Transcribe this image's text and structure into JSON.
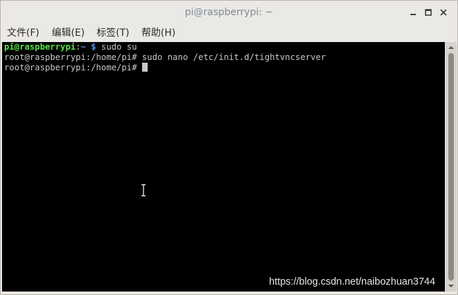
{
  "window": {
    "title": "pi@raspberrypi: ~"
  },
  "menubar": {
    "items": [
      {
        "label": "文件(F)"
      },
      {
        "label": "编辑(E)"
      },
      {
        "label": "标签(T)"
      },
      {
        "label": "帮助(H)"
      }
    ]
  },
  "terminal": {
    "lines": [
      {
        "user": "pi@raspberrypi",
        "sep": ":",
        "dir": "~ $",
        "cmd": " sudo su"
      },
      {
        "text": "root@raspberrypi:/home/pi# sudo nano /etc/init.d/tightvncserver"
      },
      {
        "text": "root@raspberrypi:/home/pi# "
      }
    ]
  },
  "watermark": {
    "text": "https://blog.csdn.net/naibozhuan3744"
  },
  "colors": {
    "terminal_bg": "#000000",
    "prompt_user": "#58e24a",
    "prompt_dir": "#5c8ef0",
    "terminal_fg": "#c8c8c8"
  },
  "icons": [
    "minimize-icon",
    "maximize-icon",
    "close-icon",
    "i-beam-cursor-icon",
    "scroll-up-icon",
    "scroll-down-icon"
  ]
}
